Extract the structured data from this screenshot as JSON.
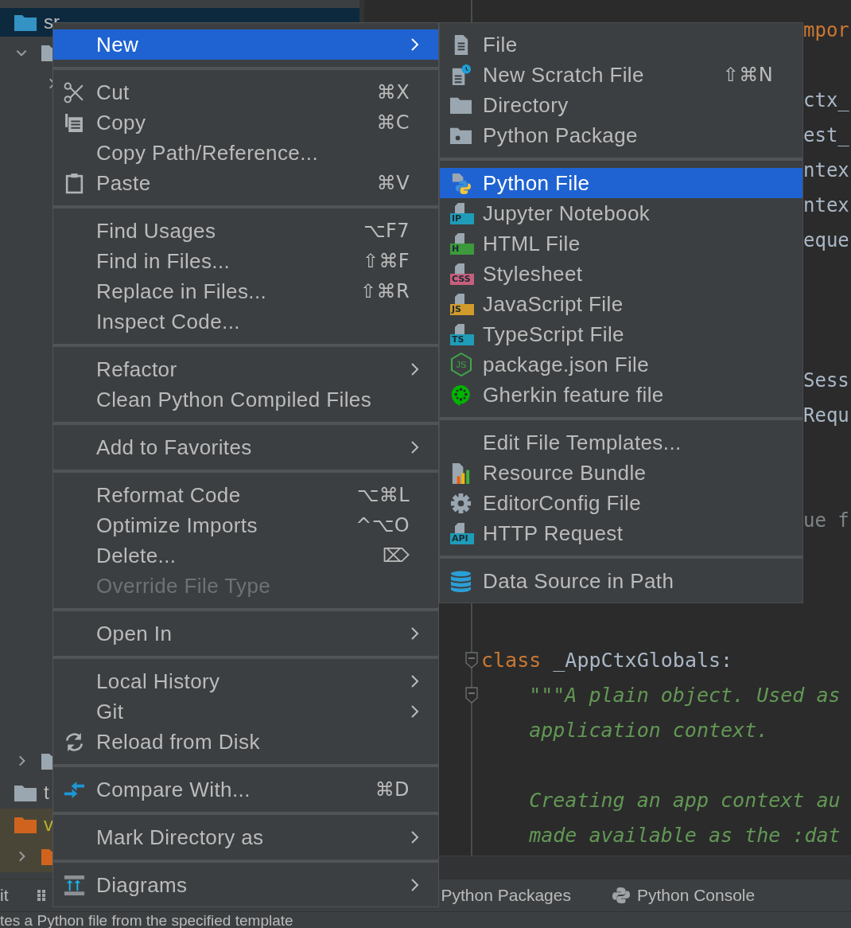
{
  "project_tree": {
    "top_rows": [
      {
        "label": "sr",
        "kind": "folder",
        "selected": true,
        "children": [
          {
            "kind": "package",
            "expanded": true,
            "children": [
              {
                "expanded": false
              }
            ]
          }
        ]
      }
    ],
    "bottom_rows": [
      {
        "kind": "package",
        "expanded": false
      },
      {
        "label": "t",
        "kind": "folder"
      },
      {
        "label": "v",
        "kind": "excluded"
      },
      {
        "kind": "excluded",
        "expanded": false
      }
    ]
  },
  "editor": {
    "partial_lines": [
      {
        "segments": [
          {
            "text": "mpor",
            "kind": "keyword"
          }
        ]
      },
      {
        "segments": [
          {
            "text": "ctx_",
            "kind": "name"
          }
        ]
      },
      {
        "segments": [
          {
            "text": "est_",
            "kind": "name"
          }
        ]
      },
      {
        "segments": [
          {
            "text": "ntex",
            "kind": "name"
          }
        ]
      },
      {
        "segments": [
          {
            "text": "ntex",
            "kind": "name"
          }
        ]
      },
      {
        "segments": [
          {
            "text": "eque",
            "kind": "name"
          }
        ]
      },
      {
        "segments": [
          {
            "text": "Sess",
            "kind": "type"
          }
        ]
      },
      {
        "segments": [
          {
            "text": "Requ",
            "kind": "type"
          }
        ]
      },
      {
        "segments": [
          {
            "text": "ue f",
            "kind": "muted"
          }
        ]
      }
    ],
    "lines": [
      {
        "folded": false,
        "segments": [
          {
            "text": "class",
            "kind": "keyword"
          },
          {
            "text": " _AppCtxGlobals:",
            "kind": "name"
          }
        ]
      },
      {
        "folded": false,
        "segments": [
          {
            "text": "    \"\"\"A plain object. Used as",
            "kind": "docstring"
          }
        ]
      },
      {
        "segments": [
          {
            "text": "    application context.",
            "kind": "docstring"
          }
        ]
      },
      {
        "segments": [
          {
            "text": "    Creating an app context au",
            "kind": "docstring"
          }
        ]
      },
      {
        "segments": [
          {
            "text": "    made available as the :dat",
            "kind": "docstring"
          }
        ]
      }
    ]
  },
  "tool_bar": {
    "left_label": "it",
    "tabs": [
      {
        "label": "Python Packages"
      },
      {
        "label": "Python Console",
        "kind": "python"
      }
    ]
  },
  "status_bar": "tes a Python file from the specified template",
  "context_menu": {
    "groups": [
      [
        {
          "label": "New",
          "submenu": true,
          "selected": true
        }
      ],
      [
        {
          "label": "Cut",
          "shortcut": "⌘X",
          "kind": "cut",
          "selected": false
        },
        {
          "label": "Copy",
          "shortcut": "⌘C",
          "kind": "copy",
          "selected": false
        },
        {
          "label": "Copy Path/Reference...",
          "selected": false
        },
        {
          "label": "Paste",
          "shortcut": "⌘V",
          "kind": "paste",
          "selected": false
        }
      ],
      [
        {
          "label": "Find Usages",
          "shortcut": "⌥F7",
          "selected": false
        },
        {
          "label": "Find in Files...",
          "shortcut": "⇧⌘F",
          "selected": false
        },
        {
          "label": "Replace in Files...",
          "shortcut": "⇧⌘R",
          "selected": false
        },
        {
          "label": "Inspect Code...",
          "selected": false
        }
      ],
      [
        {
          "label": "Refactor",
          "submenu": true,
          "selected": false
        },
        {
          "label": "Clean Python Compiled Files",
          "selected": false
        }
      ],
      [
        {
          "label": "Add to Favorites",
          "submenu": true,
          "selected": false
        }
      ],
      [
        {
          "label": "Reformat Code",
          "shortcut": "⌥⌘L",
          "selected": false
        },
        {
          "label": "Optimize Imports",
          "shortcut": "^⌥O",
          "selected": false
        },
        {
          "label": "Delete...",
          "shortcut": "⌦",
          "selected": false
        },
        {
          "label": "Override File Type",
          "disabled": true,
          "selected": false
        }
      ],
      [
        {
          "label": "Open In",
          "submenu": true,
          "selected": false
        }
      ],
      [
        {
          "label": "Local History",
          "submenu": true,
          "selected": false
        },
        {
          "label": "Git",
          "submenu": true,
          "selected": false
        },
        {
          "label": "Reload from Disk",
          "kind": "reload",
          "selected": false
        }
      ],
      [
        {
          "label": "Compare With...",
          "shortcut": "⌘D",
          "kind": "compare",
          "selected": false
        }
      ],
      [
        {
          "label": "Mark Directory as",
          "submenu": true,
          "selected": false
        }
      ],
      [
        {
          "label": "Diagrams",
          "submenu": true,
          "kind": "diagram",
          "selected": false
        }
      ]
    ]
  },
  "new_submenu": {
    "groups": [
      [
        {
          "label": "File",
          "kind": "file",
          "selected": false
        },
        {
          "label": "New Scratch File",
          "shortcut": "⇧⌘N",
          "kind": "scratch",
          "selected": false
        },
        {
          "label": "Directory",
          "kind": "folder",
          "selected": false
        },
        {
          "label": "Python Package",
          "kind": "package",
          "selected": false
        }
      ],
      [
        {
          "label": "Python File",
          "kind": "python",
          "selected": true
        },
        {
          "label": "Jupyter Notebook",
          "kind": "badge",
          "badge": "IP",
          "color": "#1e9cb8",
          "selected": false
        },
        {
          "label": "HTML File",
          "kind": "badge",
          "badge": "H",
          "color": "#3c9a3c",
          "selected": false
        },
        {
          "label": "Stylesheet",
          "kind": "badge",
          "badge": "CSS",
          "color": "#c75f7c",
          "selected": false
        },
        {
          "label": "JavaScript File",
          "kind": "badge",
          "badge": "JS",
          "color": "#d29a2b",
          "selected": false
        },
        {
          "label": "TypeScript File",
          "kind": "badge",
          "badge": "TS",
          "color": "#1e9cb8",
          "selected": false
        },
        {
          "label": "package.json File",
          "kind": "node",
          "badge": "JS",
          "selected": false
        },
        {
          "label": "Gherkin feature file",
          "kind": "gherkin",
          "selected": false
        }
      ],
      [
        {
          "label": "Edit File Templates...",
          "selected": false
        },
        {
          "label": "Resource Bundle",
          "kind": "bundle",
          "selected": false
        },
        {
          "label": "EditorConfig File",
          "kind": "gear",
          "selected": false
        },
        {
          "label": "HTTP Request",
          "kind": "badge",
          "badge": "API",
          "color": "#1e9cb8",
          "selected": false
        }
      ],
      [
        {
          "label": "Data Source in Path",
          "kind": "database",
          "selected": false
        }
      ]
    ]
  }
}
